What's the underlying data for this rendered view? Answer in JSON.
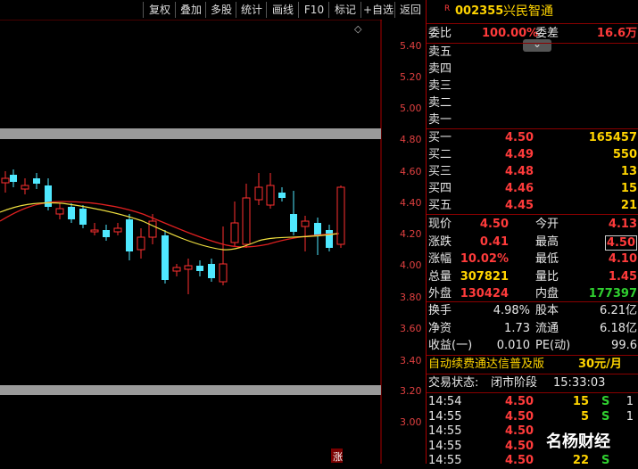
{
  "toolbar": {
    "buttons": [
      "复权",
      "叠加",
      "多股",
      "统计",
      "画线",
      "F10",
      "标记",
      "+自选",
      "返回"
    ]
  },
  "chart": {
    "y_ticks": [
      "5.40",
      "5.20",
      "5.00",
      "4.80",
      "4.60",
      "4.40",
      "4.20",
      "4.00",
      "3.80",
      "3.60",
      "3.40",
      "3.20",
      "3.00"
    ],
    "marker_text": "涨",
    "diamond": "◇",
    "chevron": "⌄"
  },
  "stock": {
    "flag": "R",
    "code": "002355",
    "name": "兴民智通"
  },
  "weibi": {
    "label": "委比",
    "value": "100.00%",
    "label2": "委差",
    "value2": "16.6万"
  },
  "sell": [
    {
      "label": "卖五",
      "price": "",
      "vol": ""
    },
    {
      "label": "卖四",
      "price": "",
      "vol": ""
    },
    {
      "label": "卖三",
      "price": "",
      "vol": ""
    },
    {
      "label": "卖二",
      "price": "",
      "vol": ""
    },
    {
      "label": "卖一",
      "price": "",
      "vol": ""
    }
  ],
  "buy": [
    {
      "label": "买一",
      "price": "4.50",
      "vol": "165457"
    },
    {
      "label": "买二",
      "price": "4.49",
      "vol": "550"
    },
    {
      "label": "买三",
      "price": "4.48",
      "vol": "13"
    },
    {
      "label": "买四",
      "price": "4.46",
      "vol": "15"
    },
    {
      "label": "买五",
      "price": "4.45",
      "vol": "21"
    }
  ],
  "quote": [
    {
      "l1": "现价",
      "v1": "4.50",
      "l2": "今开",
      "v2": "4.13"
    },
    {
      "l1": "涨跌",
      "v1": "0.41",
      "l2": "最高",
      "v2": "4.50"
    },
    {
      "l1": "涨幅",
      "v1": "10.02%",
      "l2": "最低",
      "v2": "4.10"
    },
    {
      "l1": "总量",
      "v1": "307821",
      "l2": "量比",
      "v2": "1.45"
    },
    {
      "l1": "外盘",
      "v1": "130424",
      "l2": "内盘",
      "v2": "177397"
    }
  ],
  "stats": [
    {
      "l1": "换手",
      "v1": "4.98%",
      "l2": "股本",
      "v2": "6.21亿"
    },
    {
      "l1": "净资",
      "v1": "1.73",
      "l2": "流通",
      "v2": "6.18亿"
    },
    {
      "l1": "收益(一)",
      "v1": "0.010",
      "l2": "PE(动)",
      "v2": "99.6"
    }
  ],
  "promo": {
    "text": "自动续费通达信普及版",
    "price": "30元/月"
  },
  "status": {
    "label": "交易状态:",
    "value": "闭市阶段",
    "time": "15:33:03"
  },
  "ticks": [
    {
      "time": "14:54",
      "price": "4.50",
      "vol": "15",
      "side": "S",
      "n": "1"
    },
    {
      "time": "14:55",
      "price": "4.50",
      "vol": "5",
      "side": "S",
      "n": "1"
    },
    {
      "time": "14:55",
      "price": "4.50",
      "vol": "",
      "side": "",
      "n": ""
    },
    {
      "time": "14:55",
      "price": "4.50",
      "vol": "",
      "side": "",
      "n": ""
    },
    {
      "time": "14:55",
      "price": "4.50",
      "vol": "22",
      "side": "S",
      "n": ""
    }
  ],
  "watermark": "名杨财经"
}
